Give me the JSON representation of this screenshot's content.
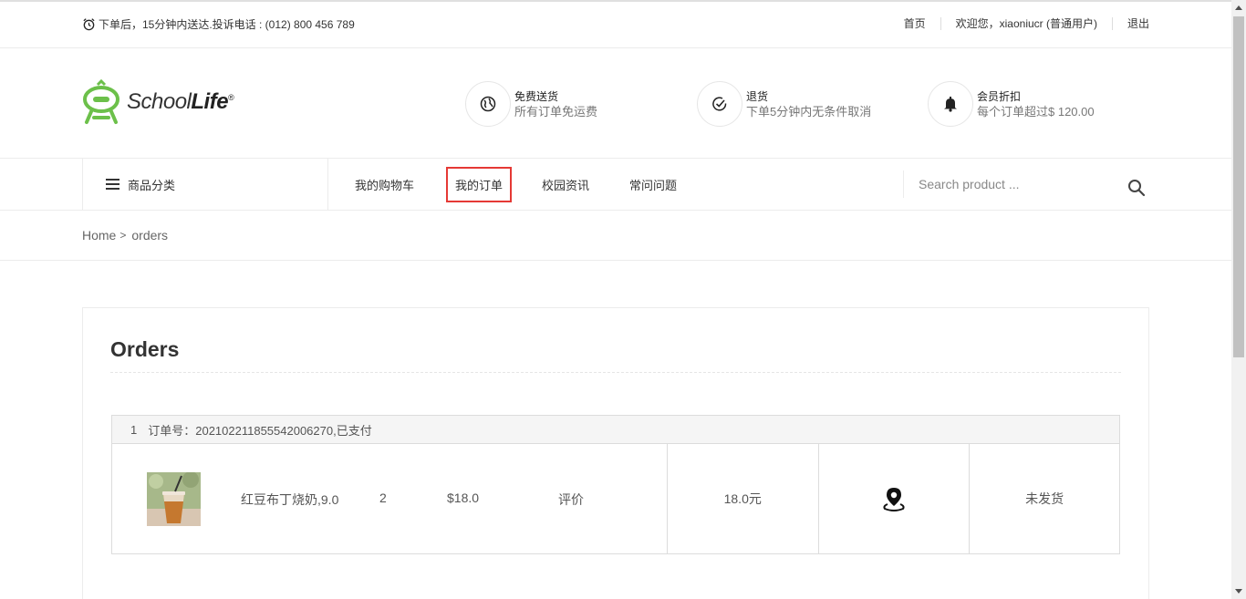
{
  "topbar": {
    "notice": "下单后，15分钟内送达.投诉电话 : (012) 800 456 789",
    "home": "首页",
    "welcome": "欢迎您，xiaoniucr (普通用户)",
    "logout": "退出"
  },
  "logo": {
    "school": "School",
    "life": "Life",
    "mark": "®"
  },
  "features": [
    {
      "title": "免费送货",
      "desc": "所有订单免运费",
      "icon": "globe-icon"
    },
    {
      "title": "退货",
      "desc": "下单5分钟内无条件取消",
      "icon": "check-circle-icon"
    },
    {
      "title": "会员折扣",
      "desc": "每个订单超过$ 120.00",
      "icon": "bell-icon"
    }
  ],
  "nav": {
    "category": "商品分类",
    "items": [
      "我的购物车",
      "我的订单",
      "校园资讯",
      "常问问题"
    ],
    "active_index": 1,
    "active_color": "#e53935",
    "search_placeholder": "Search product ..."
  },
  "breadcrumb": {
    "home": "Home",
    "arrow": ">",
    "current": "orders"
  },
  "orders": {
    "title": "Orders",
    "list": [
      {
        "index": "1",
        "header": "订单号：20210221185554200627​0,已支付",
        "product_name": "红豆布丁烧奶,9.0",
        "quantity": "2",
        "price": "$18.0",
        "review": "评价",
        "total": "18.0元",
        "status": "未发货"
      }
    ]
  }
}
